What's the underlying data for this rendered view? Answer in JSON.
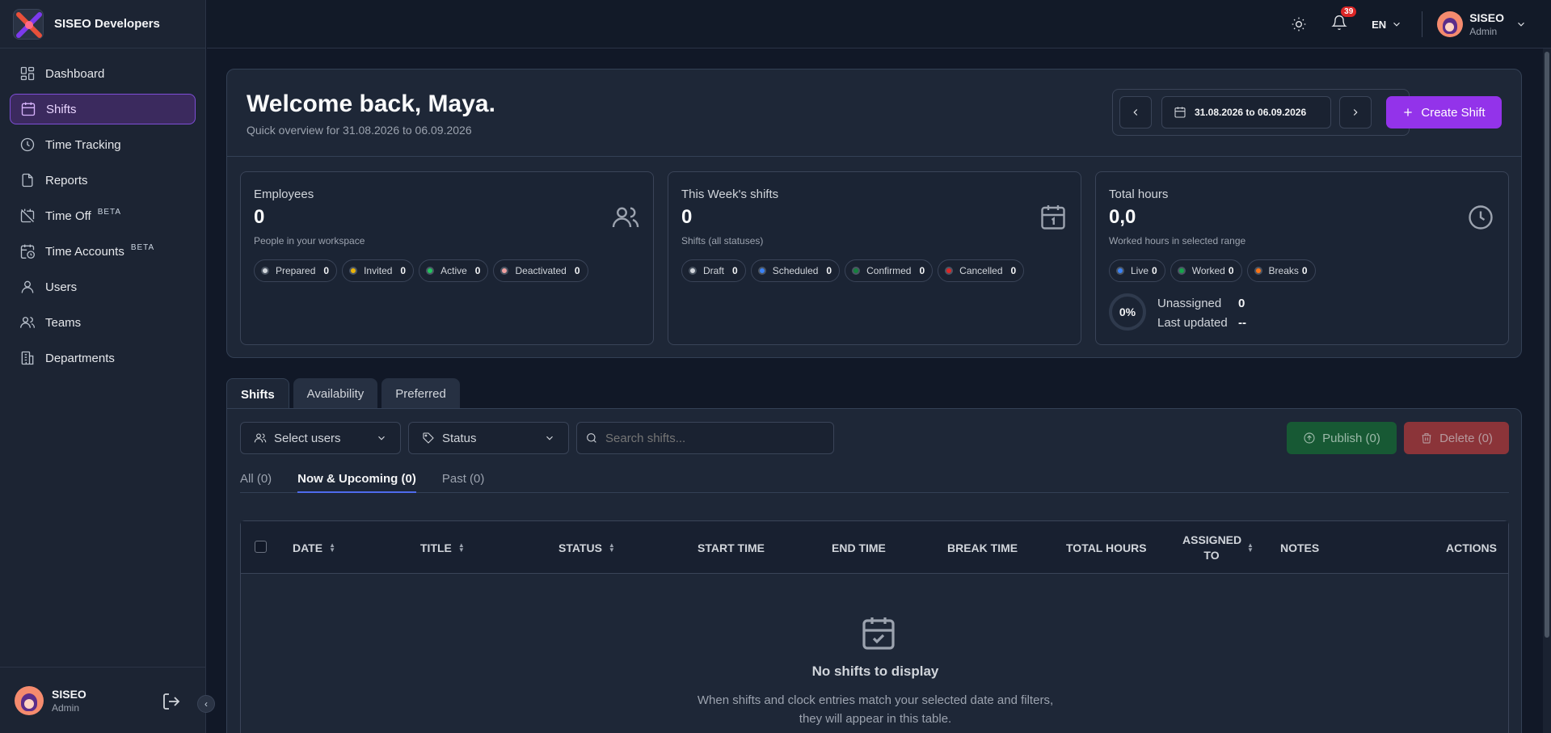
{
  "app": {
    "name": "SISEO Developers"
  },
  "sidebar": {
    "items": [
      {
        "label": "Dashboard",
        "icon": "grid-icon"
      },
      {
        "label": "Shifts",
        "icon": "calendar-icon",
        "active": true
      },
      {
        "label": "Time Tracking",
        "icon": "clock-icon"
      },
      {
        "label": "Reports",
        "icon": "file-icon"
      },
      {
        "label": "Time Off",
        "icon": "calendar-off-icon",
        "badge": "BETA"
      },
      {
        "label": "Time Accounts",
        "icon": "calendar-clock-icon",
        "badge": "BETA"
      },
      {
        "label": "Users",
        "icon": "user-icon"
      },
      {
        "label": "Teams",
        "icon": "users-icon"
      },
      {
        "label": "Departments",
        "icon": "building-icon"
      }
    ],
    "user": {
      "name": "SISEO",
      "role": "Admin"
    }
  },
  "topbar": {
    "notifications": "39",
    "language": "EN",
    "user": {
      "name": "SISEO",
      "role": "Admin"
    }
  },
  "overview": {
    "welcome": "Welcome back, Maya.",
    "subtitle": "Quick overview for 31.08.2026 to 06.09.2026",
    "range": "31.08.2026 to 06.09.2026",
    "create_label": "Create Shift",
    "employees": {
      "label": "Employees",
      "value": "0",
      "sub": "People in your workspace",
      "pills": [
        {
          "label": "Prepared",
          "count": "0",
          "color": "#d1d5db"
        },
        {
          "label": "Invited",
          "count": "0",
          "color": "#eab308"
        },
        {
          "label": "Active",
          "count": "0",
          "color": "#22c55e"
        },
        {
          "label": "Deactivated",
          "count": "0",
          "color": "#f0a0a0"
        }
      ]
    },
    "week_shifts": {
      "label": "This Week's shifts",
      "value": "0",
      "sub": "Shifts (all statuses)",
      "pills": [
        {
          "label": "Draft",
          "count": "0",
          "color": "#d1d5db"
        },
        {
          "label": "Scheduled",
          "count": "0",
          "color": "#3b82f6"
        },
        {
          "label": "Confirmed",
          "count": "0",
          "color": "#15803d"
        },
        {
          "label": "Cancelled",
          "count": "0",
          "color": "#dc2626"
        }
      ]
    },
    "total_hours": {
      "label": "Total hours",
      "value": "0,0",
      "sub": "Worked hours in selected range",
      "pills": [
        {
          "label": "Live",
          "count": "0",
          "color": "#3b82f6"
        },
        {
          "label": "Worked",
          "count": "0",
          "color": "#16a34a"
        },
        {
          "label": "Breaks",
          "count": "0",
          "color": "#f97316"
        }
      ],
      "ring": "0%",
      "unassigned_label": "Unassigned",
      "unassigned_value": "0",
      "updated_label": "Last updated",
      "updated_value": "--"
    }
  },
  "tabs": [
    "Shifts",
    "Availability",
    "Preferred"
  ],
  "filters": {
    "users": "Select users",
    "status": "Status",
    "search_placeholder": "Search shifts...",
    "publish": "Publish (0)",
    "delete": "Delete (0)"
  },
  "subtabs": [
    "All (0)",
    "Now & Upcoming (0)",
    "Past (0)"
  ],
  "table": {
    "columns": [
      "DATE",
      "TITLE",
      "STATUS",
      "START TIME",
      "END TIME",
      "BREAK TIME",
      "TOTAL HOURS",
      "ASSIGNED TO",
      "NOTES",
      "ACTIONS"
    ],
    "empty_title": "No shifts to display",
    "empty_line1": "When shifts and clock entries match your selected date and filters,",
    "empty_line2": "they will appear in this table."
  }
}
